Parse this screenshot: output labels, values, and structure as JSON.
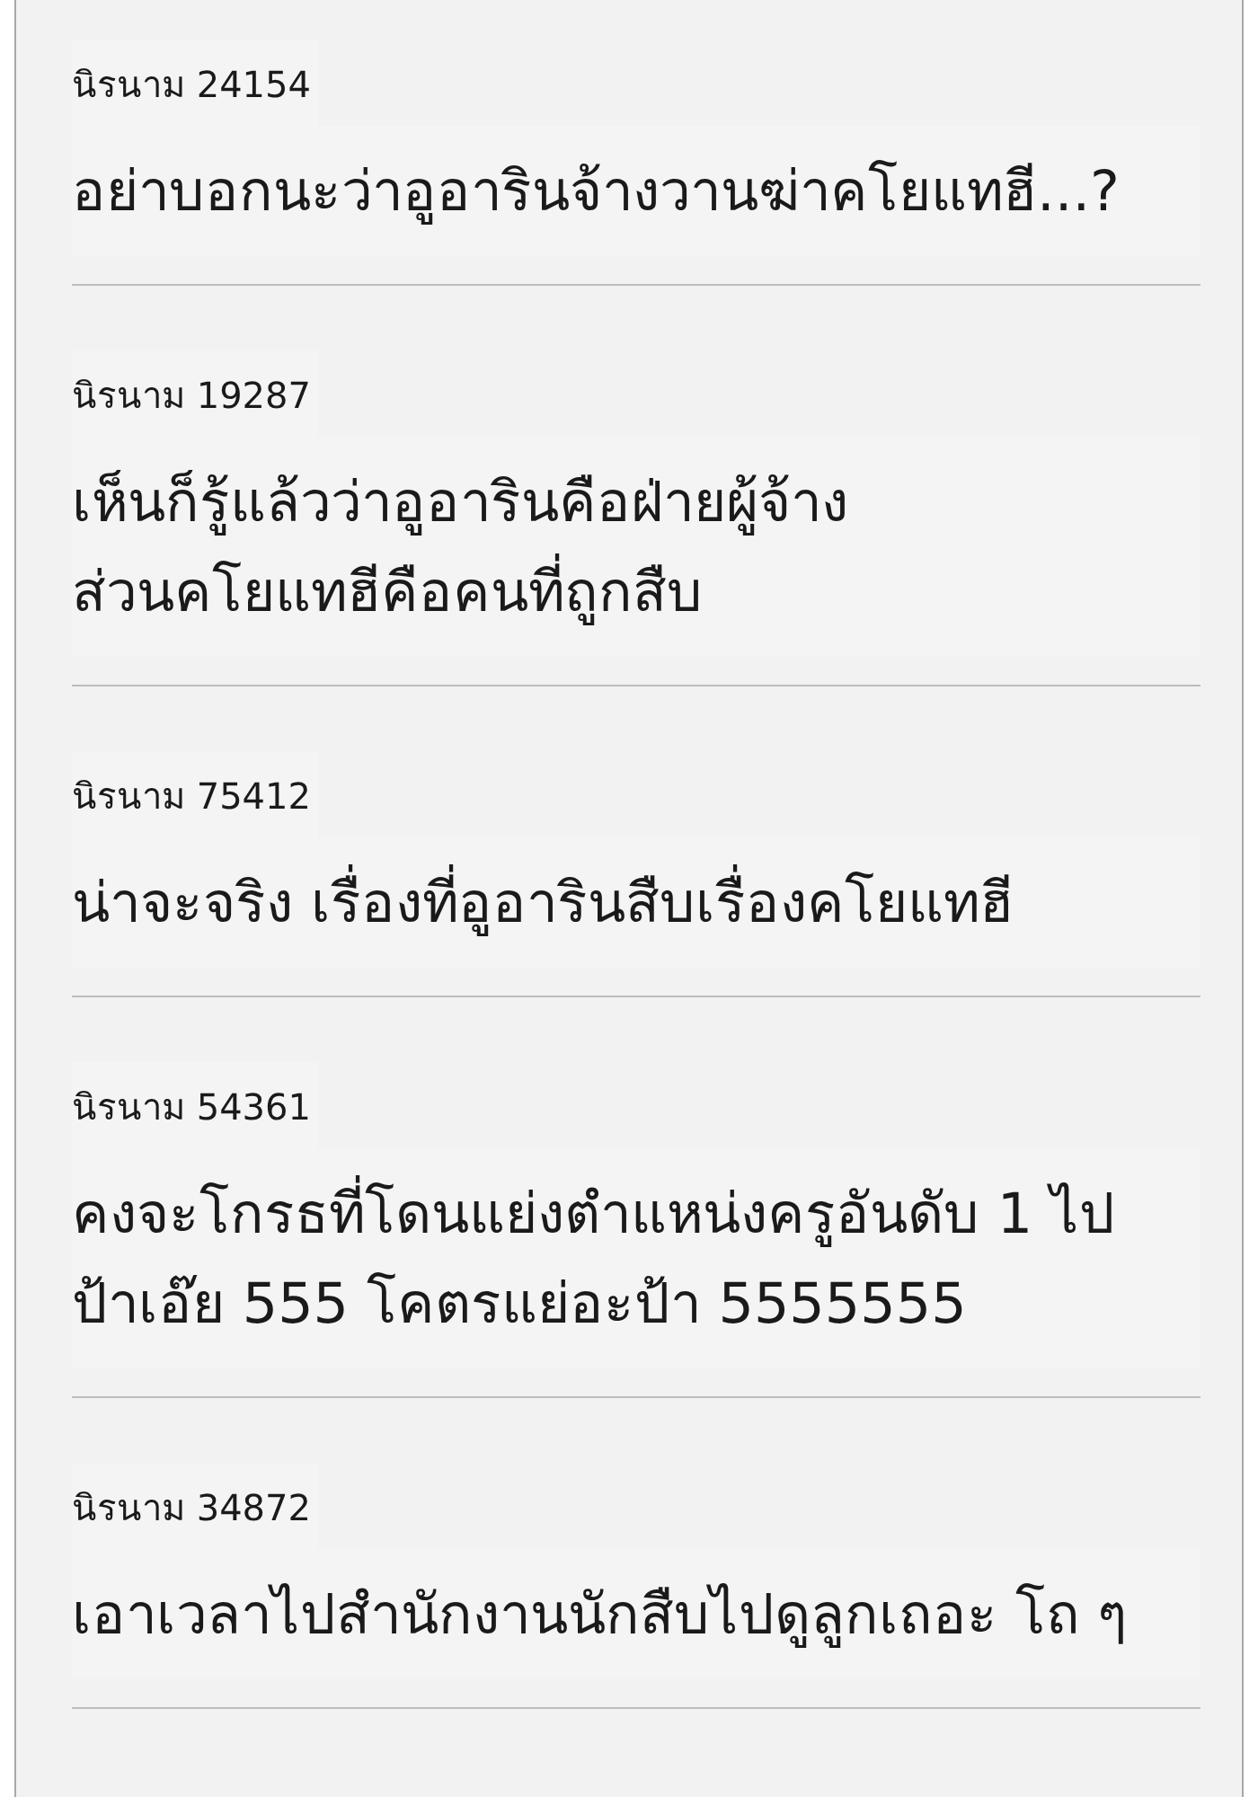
{
  "comments": [
    {
      "author": "นิรนาม 24154",
      "text": "อย่าบอกนะว่าอูอารินจ้างวานฆ่าคโยแทฮี...?"
    },
    {
      "author": "นิรนาม 19287",
      "text": "เห็นก็รู้แล้วว่าอูอารินคือฝ่ายผู้จ้าง\nส่วนคโยแทฮีคือคนที่ถูกสืบ"
    },
    {
      "author": "นิรนาม 75412",
      "text": "น่าจะจริง เรื่องที่อูอารินสืบเรื่องคโยแทฮี"
    },
    {
      "author": "นิรนาม 54361",
      "text": "คงจะโกรธที่โดนแย่งตำแหน่งครูอันดับ 1 ไป\nป้าเอ๊ย 555 โคตรแย่อะป้า 5555555"
    },
    {
      "author": "นิรนาม 34872",
      "text": "เอาเวลาไปสำนักงานนักสืบไปดูลูกเถอะ โถ ๆ"
    }
  ]
}
